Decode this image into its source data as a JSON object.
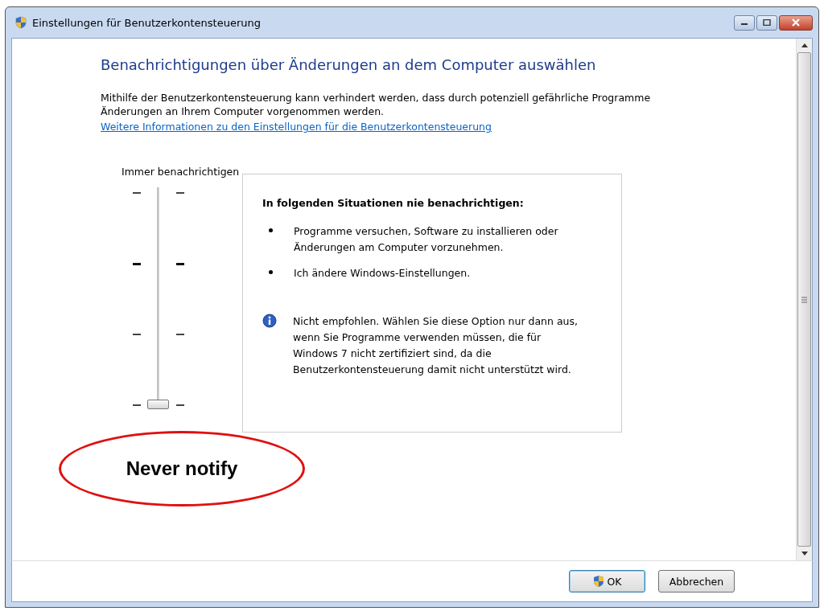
{
  "window": {
    "title": "Einstellungen für Benutzerkontensteuerung"
  },
  "heading": "Benachrichtigungen über Änderungen an dem Computer auswählen",
  "description": "Mithilfe der Benutzerkontensteuerung kann verhindert werden, dass durch potenziell gefährliche Programme Änderungen an Ihrem Computer vorgenommen werden.",
  "link": "Weitere Informationen zu den Einstellungen für die Benutzerkontensteuerung",
  "slider": {
    "top_label": "Immer benachrichtigen",
    "level": 0
  },
  "info_panel": {
    "title": "In folgenden Situationen nie benachrichtigen:",
    "items": [
      "Programme versuchen, Software zu installieren oder Änderungen am Computer vorzunehmen.",
      "Ich ändere Windows-Einstellungen."
    ],
    "note": "Nicht empfohlen. Wählen Sie diese Option nur dann aus, wenn Sie Programme verwenden müssen, die für Windows 7 nicht zertifiziert sind, da die Benutzerkontensteuerung damit nicht unterstützt wird."
  },
  "annotation": {
    "text": "Never notify"
  },
  "buttons": [
    {
      "label": "OK",
      "kind": "shield",
      "default": true
    },
    {
      "label": "Abbrechen",
      "kind": "plain",
      "default": false
    }
  ]
}
